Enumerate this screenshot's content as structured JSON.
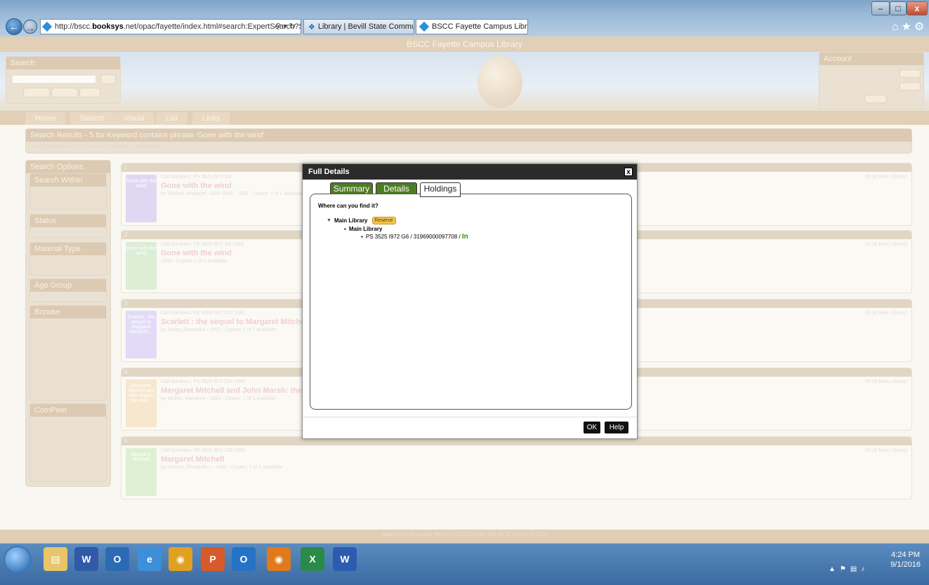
{
  "browser": {
    "address": "http://bscc.booksys.net/opac/fayette/index.html#search:ExpertSearch?ST",
    "address_host_bold": "booksys",
    "tabs": [
      {
        "label": "Library | Bevill State Communit..."
      },
      {
        "label": "BSCC Fayette Campus Library",
        "close": "×"
      }
    ],
    "window_controls": [
      "–",
      "□",
      "x"
    ]
  },
  "page": {
    "title": "BSCC Fayette Campus Library",
    "search_box_title": "Search",
    "account_title": "Account",
    "nav_tabs": [
      "Home",
      "Search",
      "Visual",
      "List",
      "Links"
    ],
    "results_header": "Search Results - 5 for Keyword contains phrase 'Gone with the wind'",
    "sort_by": "Sort By:  Relevance  |  Title  |  Author  |  Copyright  |  Call Number",
    "sidebar": [
      "Search Options",
      "Search Within",
      "Status",
      "Material Type",
      "Age Group",
      "Browse",
      "ComPeer"
    ],
    "results": [
      {
        "num": "1",
        "call": "Call Numbers: PS 3525 I972 G6",
        "title": "Gone with the wind",
        "by": "by Mitchell, Margaret, 1900-1949 - 1936 - Copies: 1 of 1 available",
        "cover": "Gone with the wind",
        "cover_color": "#c7b9e9",
        "loc": "IN  (at Main Library)"
      },
      {
        "num": "2",
        "call": "Call Numbers: PS 3525 I972 G6 1939",
        "title": "Gone with the wind",
        "by": "1939 - Copies: 1 of 1 available",
        "cover": "Gone with the wind",
        "cover_color": "#bfe0b4",
        "loc": "IN  (at Main Library)"
      },
      {
        "num": "3",
        "call": "Call Numbers: PS 3568 I597 S37 1991",
        "title": "Scarlett : the sequel to Margaret Mitchel",
        "by": "by Ripley, Alexandra - 1991 - Copies: 1 of 1 available",
        "cover": "Scarlett : the sequel to Margaret Mitchell's...",
        "cover_color": "#c9bdf0",
        "loc": "IN  (at Main Library)"
      },
      {
        "num": "4",
        "call": "Call Numbers: PS 3525 I972 Z94 1993",
        "title": "Margaret Mitchell and John Marsh: the l",
        "by": "by Walker, Marianne - 1993 - Copies: 1 of 1 available",
        "cover": "Margaret Mitchell and John Marsh: the love...",
        "cover_color": "#f0d3a8",
        "loc": "IN  (at Main Library)"
      },
      {
        "num": "5",
        "call": "Call Numbers: PS 3525 I972 Z65 1990",
        "title": "Margaret Mitchell",
        "by": "by Hanson, Elizabeth I. - 1990 - Copies: 1 of 1 available",
        "cover": "Margaret Mitchell",
        "cover_color": "#c4e3b0",
        "loc": "IN  (at Main Library)"
      }
    ],
    "footer": "powered by Alexandria Version 7.0.3.2.222 Mon Nov 16 11:13:30 CST 2015"
  },
  "dialog": {
    "title": "Full Details",
    "close": "x",
    "tabs": [
      "Summary",
      "Details",
      "Holdings"
    ],
    "selected_tab": "Holdings",
    "where_label": "Where can you find it?",
    "location": "Main Library",
    "reserve_label": "Reserve",
    "sublocation": "Main Library",
    "item_text": "PS 3525 I972 G6 / 31969000097708 / ",
    "item_status": "In",
    "ok_label": "OK",
    "help_label": "Help"
  },
  "taskbar": {
    "time": "4:24 PM",
    "date": "9/1/2016"
  }
}
